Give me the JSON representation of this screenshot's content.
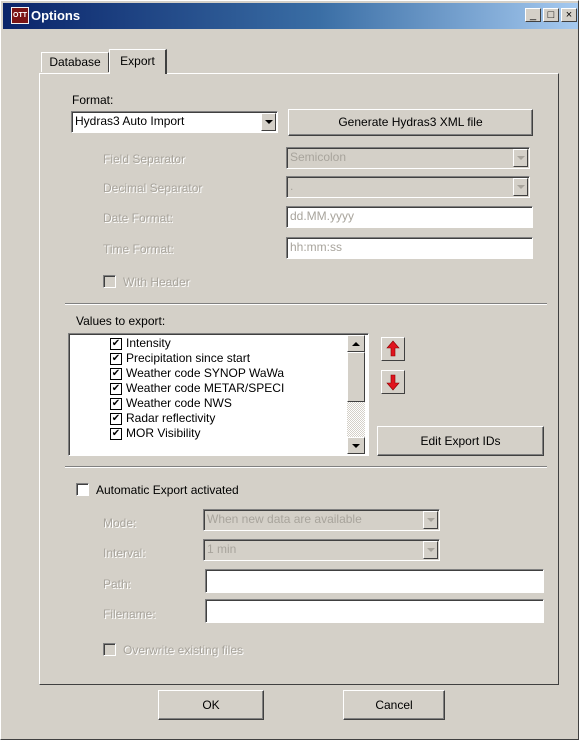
{
  "window": {
    "title": "Options",
    "app_icon_text": "OTT",
    "minimize_glyph": "_",
    "maximize_glyph": "□",
    "close_glyph": "×"
  },
  "tabs": [
    {
      "label": "Database",
      "selected": false
    },
    {
      "label": "Export",
      "selected": true
    }
  ],
  "format": {
    "label": "Format:",
    "selected": "Hydras3 Auto Import",
    "generate_button": "Generate Hydras3 XML file"
  },
  "fields": {
    "field_separator": {
      "label": "Field Separator",
      "value": "Semicolon"
    },
    "decimal_separator": {
      "label": "Decimal Separator",
      "value": "."
    },
    "date_format": {
      "label": "Date Format:",
      "value": "dd.MM.yyyy"
    },
    "time_format": {
      "label": "Time Format:",
      "value": "hh:mm:ss"
    },
    "with_header": {
      "label": "With Header",
      "checked": false
    }
  },
  "values_to_export": {
    "label": "Values to export:",
    "items": [
      {
        "label": "Intensity",
        "checked": true
      },
      {
        "label": "Precipitation since start",
        "checked": true
      },
      {
        "label": "Weather code SYNOP WaWa",
        "checked": true
      },
      {
        "label": "Weather code METAR/SPECI",
        "checked": true
      },
      {
        "label": "Weather code NWS",
        "checked": true
      },
      {
        "label": "Radar reflectivity",
        "checked": true
      },
      {
        "label": "MOR Visibility",
        "checked": true
      }
    ],
    "edit_ids_button": "Edit Export IDs"
  },
  "automatic_export": {
    "label": "Automatic Export activated",
    "checked": false,
    "mode": {
      "label": "Mode:",
      "value": "When new data are available"
    },
    "interval": {
      "label": "Interval:",
      "value": "1 min"
    },
    "path": {
      "label": "Path:",
      "value": ""
    },
    "filename": {
      "label": "Filename:",
      "value": ""
    },
    "overwrite": {
      "label": "Overwrite existing files",
      "checked": false
    }
  },
  "buttons": {
    "ok": "OK",
    "cancel": "Cancel"
  },
  "colors": {
    "face": "#d4d0c8",
    "title_start": "#0a246a",
    "title_end": "#a6caf0",
    "arrow_red": "#e0141e",
    "disabled_text": "#a8a49c"
  }
}
